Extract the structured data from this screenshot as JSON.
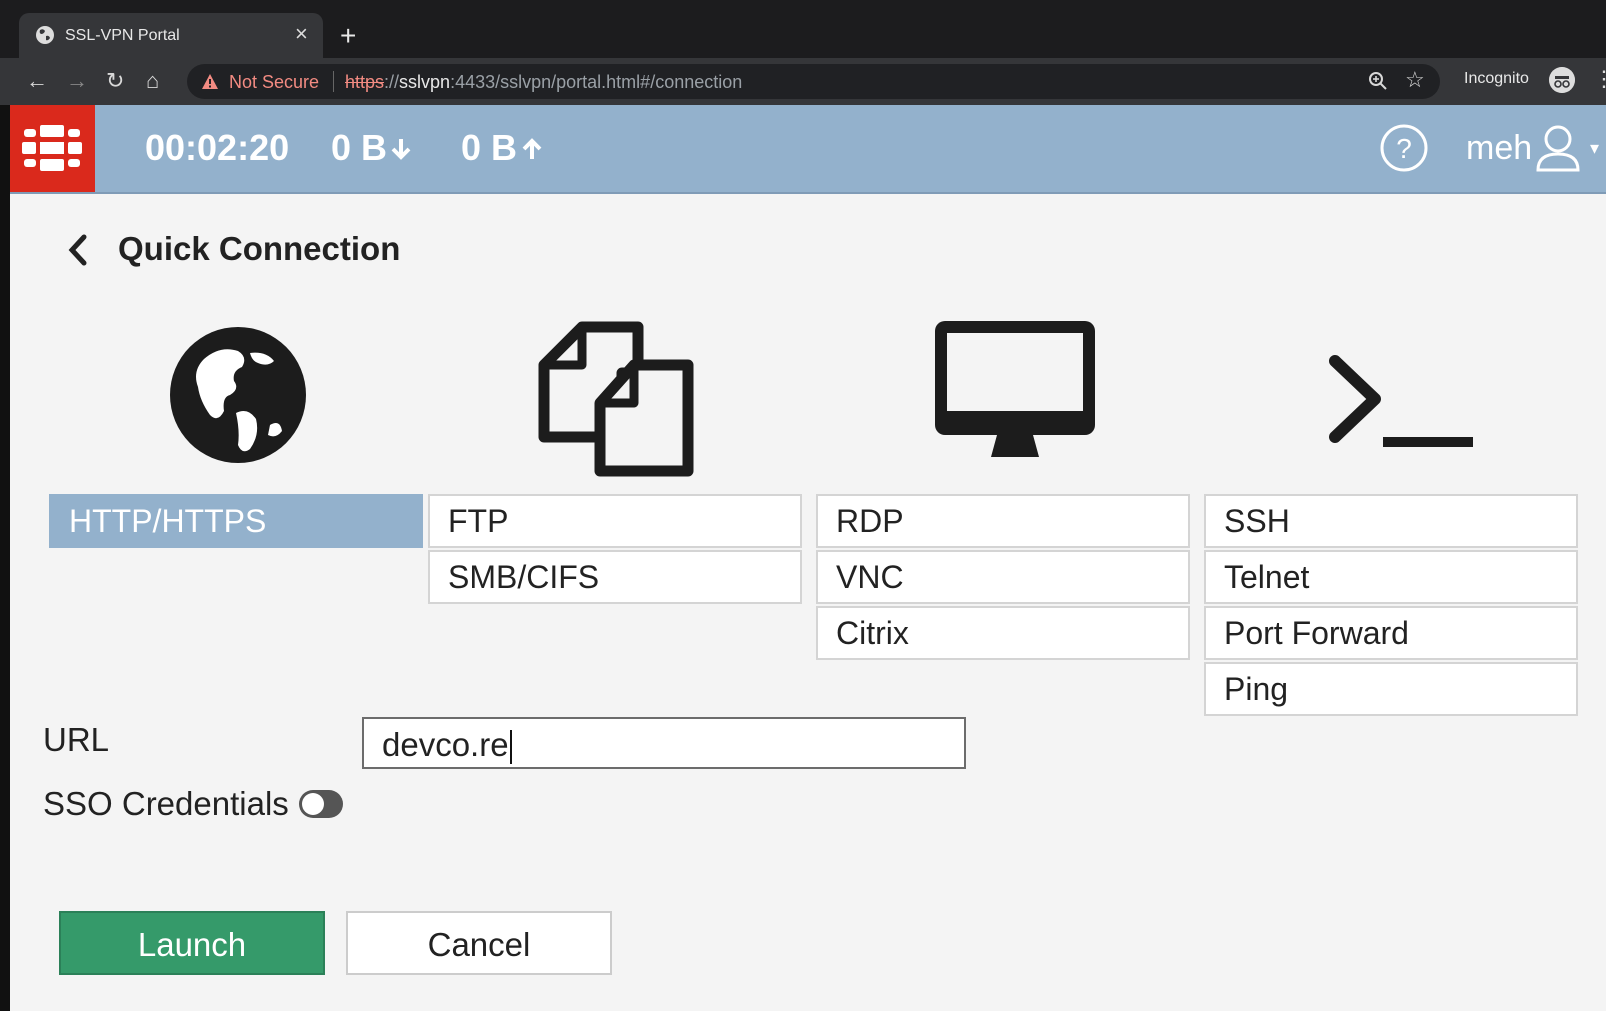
{
  "browser": {
    "tab_title": "SSL-VPN Portal",
    "new_tab": "+",
    "security_label": "Not Secure",
    "url_scheme": "https",
    "url_sep": "://",
    "url_host": "sslvpn",
    "url_path": ":4433/sslvpn/portal.html#/connection",
    "incognito_label": "Incognito"
  },
  "portal_header": {
    "session_time": "00:02:20",
    "bytes_down": "0 B",
    "bytes_up": "0 B",
    "user_name": "meh",
    "brand_color": "#da291c",
    "header_color": "#93b1cc"
  },
  "page": {
    "title": "Quick Connection"
  },
  "protocols": [
    {
      "icon": "globe-icon",
      "options": [
        "HTTP/HTTPS"
      ]
    },
    {
      "icon": "files-icon",
      "options": [
        "FTP",
        "SMB/CIFS"
      ]
    },
    {
      "icon": "desktop-icon",
      "options": [
        "RDP",
        "VNC",
        "Citrix"
      ]
    },
    {
      "icon": "terminal-icon",
      "options": [
        "SSH",
        "Telnet",
        "Port Forward",
        "Ping"
      ]
    }
  ],
  "selected_protocol": "HTTP/HTTPS",
  "form": {
    "url_label": "URL",
    "url_value": "devco.re",
    "sso_label": "SSO Credentials",
    "sso_enabled": false
  },
  "actions": {
    "launch_label": "Launch",
    "cancel_label": "Cancel",
    "launch_color": "#359a6a"
  }
}
